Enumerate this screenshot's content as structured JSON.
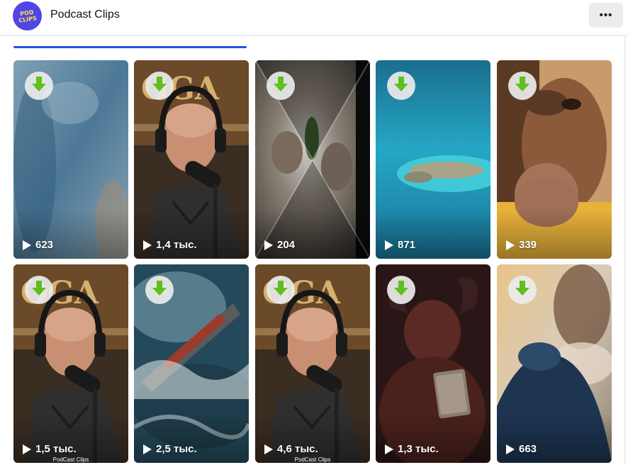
{
  "header": {
    "channel_name": "Podcast Clips",
    "avatar_text": "POD CLIPS",
    "menu_label": "•••"
  },
  "colors": {
    "accent": "#2351d8",
    "download": "#5fbf1d"
  },
  "clips": [
    {
      "views": "623",
      "thumb": "blurred-blue-abstract"
    },
    {
      "views": "1,4 тыс.",
      "thumb": "podcast-host-headphones-mic"
    },
    {
      "views": "204",
      "thumb": "zoom-blur-faces"
    },
    {
      "views": "871",
      "thumb": "aerial-island-ocean"
    },
    {
      "views": "339",
      "thumb": "woman-hands-over-mouth"
    },
    {
      "views": "1,5 тыс.",
      "thumb": "podcast-host-headphones-mic",
      "watermark": "PodCast Clips"
    },
    {
      "views": "2,5 тыс.",
      "thumb": "ship-in-storm-waves"
    },
    {
      "views": "4,6 тыс.",
      "thumb": "podcast-host-headphones-mic",
      "watermark": "PodCast Clips"
    },
    {
      "views": "1,3 тыс.",
      "thumb": "horned-demon-with-book"
    },
    {
      "views": "663",
      "thumb": "blurred-woman-motion"
    }
  ]
}
